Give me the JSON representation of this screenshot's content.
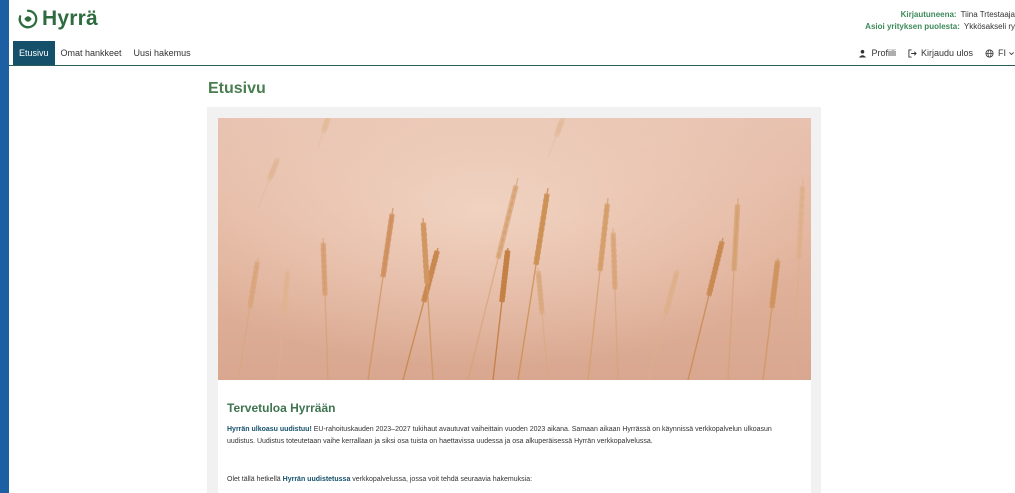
{
  "app": {
    "logo_text": "Hyrrä"
  },
  "user": {
    "logged_in_label": "Kirjautuneena:",
    "logged_in_value": "Tiina Trtestaaja",
    "company_label": "Asioi yrityksen puolesta:",
    "company_value": "Ykkösakseli ry"
  },
  "nav": {
    "items": [
      "Etusivu",
      "Omat hankkeet",
      "Uusi hakemus"
    ],
    "profile": "Profiili",
    "logout": "Kirjaudu ulos",
    "language": "FI"
  },
  "page": {
    "title": "Etusivu",
    "welcome_title": "Tervetuloa Hyrrään",
    "p1_strong": "Hyrrän ulkoasu uudistuu!",
    "p1_text": " EU-rahoituskauden 2023–2027 tukihaut avautuvat vaiheittain vuoden 2023 aikana. Samaan aikaan Hyrrässä on käynnissä verkkopalvelun ulkoasun uudistus. Uudistus toteutetaan vaihe kerrallaan ja siksi osa tuista on haettavissa uudessa ja osa alkuperäisessä Hyrrän verkkopalvelussa.",
    "p2_pre": "Olet tällä hetkellä ",
    "p2_strong": "Hyrrän uudistetussa",
    "p2_post": " verkkopalvelussa, jossa voit tehdä seuraavia hakemuksia:"
  },
  "colors": {
    "brand_green": "#2e6b3f",
    "nav_active": "#14506a",
    "left_strip": "#1c5fa3"
  }
}
